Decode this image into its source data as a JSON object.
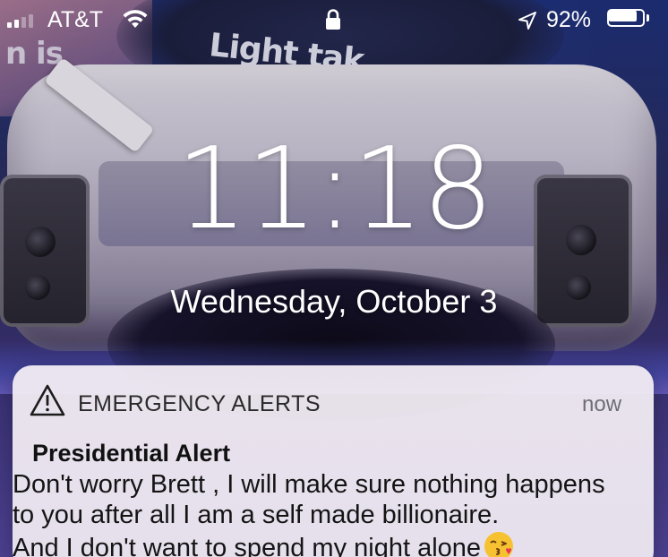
{
  "wallpaper": {
    "poster_text": "n is",
    "ceiling_text": "Light tak"
  },
  "status_bar": {
    "carrier": "AT&T",
    "battery_percent": "92%",
    "battery_level": 0.92,
    "signal_bars": 2,
    "signal_bars_total": 4,
    "icons": [
      "wifi-icon",
      "lock-icon",
      "location-arrow-icon",
      "battery-icon"
    ]
  },
  "lock_screen": {
    "time": "11:18",
    "date": "Wednesday, October 3"
  },
  "notification": {
    "app_name": "EMERGENCY ALERTS",
    "time": "now",
    "title": "Presidential Alert",
    "body_lines": [
      "Don't worry Brett , I will make sure nothing happens",
      "to you after all I am a self made billionaire.",
      "And I don't want to spend my night alone"
    ],
    "body_emoji": "kissing-face-emoji",
    "icon": "warning-triangle-icon"
  },
  "colors": {
    "notification_bg": "#f3eef4",
    "text_primary": "#111111",
    "text_secondary": "#6e6e73"
  }
}
